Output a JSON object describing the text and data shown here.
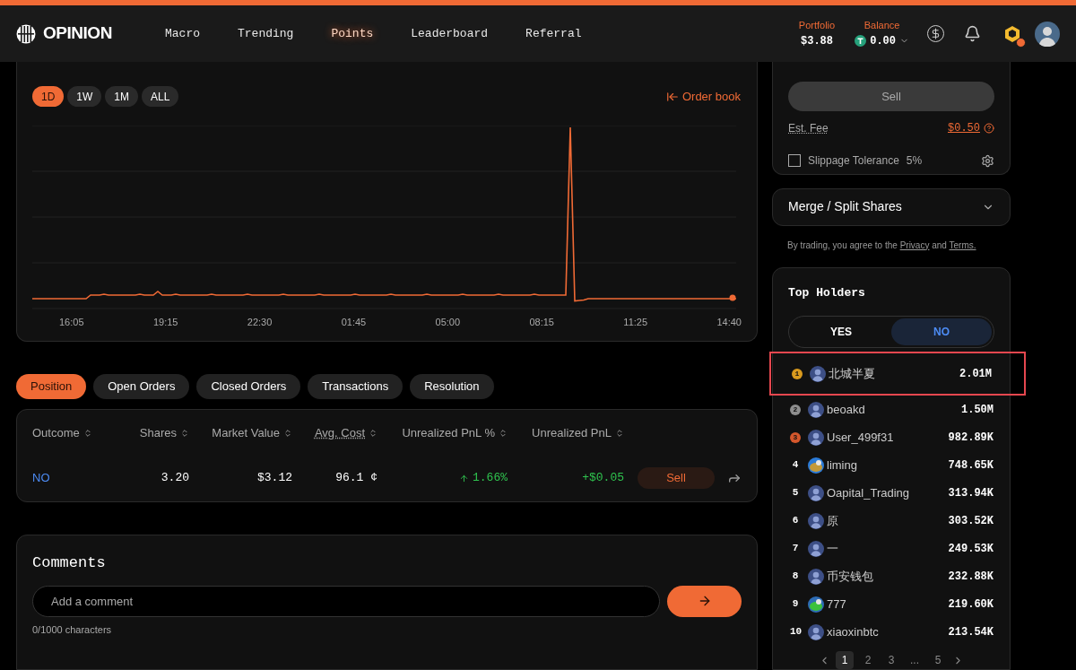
{
  "nav": {
    "logo": "OPINION",
    "links": [
      {
        "label": "Macro",
        "selected": false
      },
      {
        "label": "Trending",
        "selected": false
      },
      {
        "label": "Points",
        "selected": true
      },
      {
        "label": "Leaderboard",
        "selected": false
      },
      {
        "label": "Referral",
        "selected": false
      }
    ]
  },
  "portfolio": {
    "label": "Portfolio",
    "value": "$3.88"
  },
  "balance": {
    "label": "Balance",
    "value": "0.00"
  },
  "chart": {
    "ranges": [
      {
        "label": "1D",
        "selected": true
      },
      {
        "label": "1W",
        "selected": false
      },
      {
        "label": "1M",
        "selected": false
      },
      {
        "label": "ALL",
        "selected": false
      }
    ],
    "order_book": "Order book",
    "x_labels": [
      "16:05",
      "19:15",
      "22:30",
      "01:45",
      "05:00",
      "08:15",
      "11:25",
      "14:40"
    ]
  },
  "position_tabs": [
    {
      "label": "Position",
      "selected": true
    },
    {
      "label": "Open Orders",
      "selected": false
    },
    {
      "label": "Closed Orders",
      "selected": false
    },
    {
      "label": "Transactions",
      "selected": false
    },
    {
      "label": "Resolution",
      "selected": false
    }
  ],
  "positions": {
    "columns": [
      {
        "label": "Outcome",
        "hint": false
      },
      {
        "label": "Shares",
        "hint": false
      },
      {
        "label": "Market Value",
        "hint": false
      },
      {
        "label": "Avg. Cost",
        "hint": true
      },
      {
        "label": "Unrealized PnL %",
        "hint": false
      },
      {
        "label": "Unrealized PnL",
        "hint": false
      }
    ],
    "rows": [
      {
        "outcome": "NO",
        "shares": "3.20",
        "market_value": "$3.12",
        "avg_cost": "96.1 ¢",
        "pnl_pct": "1.66%",
        "pnl": "+$0.05",
        "action": "Sell"
      }
    ]
  },
  "comments": {
    "title": "Comments",
    "placeholder": "Add a comment",
    "counter": "0/1000 characters"
  },
  "trade": {
    "sell_button": "Sell",
    "fee_label": "Est. Fee",
    "fee": "$0.50",
    "slippage": {
      "label": "Slippage Tolerance",
      "value": "5%",
      "checked": false
    }
  },
  "merge": {
    "label": "Merge / Split Shares",
    "expanded": false
  },
  "terms": {
    "text": "By trading, you agree to the",
    "privacy": "Privacy",
    "and": "and",
    "terms": "Terms."
  },
  "holders": {
    "title": "Top Holders",
    "tabs": [
      {
        "label": "YES",
        "selected": false
      },
      {
        "label": "NO",
        "selected": true
      }
    ],
    "rows": [
      {
        "rank": "1",
        "kind": "medal",
        "color": "#d99a1e",
        "avatar": {
          "kind": "default"
        },
        "name": "北城半夏",
        "amount": "2.01M",
        "highlighted": true
      },
      {
        "rank": "2",
        "kind": "medal",
        "color": "#8e8e8e",
        "avatar": {
          "kind": "default"
        },
        "name": "beoakd",
        "amount": "1.50M",
        "highlighted": false
      },
      {
        "rank": "3",
        "kind": "medal",
        "color": "#d4572c",
        "avatar": {
          "kind": "default"
        },
        "name": "User_499f31",
        "amount": "982.89K",
        "highlighted": false
      },
      {
        "rank": "4",
        "kind": "plain",
        "name": "liming",
        "amount": "748.65K",
        "highlighted": false
      },
      {
        "rank": "5",
        "kind": "plain",
        "avatar": {
          "kind": "default"
        },
        "name": "Oapital_Trading",
        "amount": "313.94K",
        "highlighted": false
      },
      {
        "rank": "6",
        "kind": "plain",
        "avatar": {
          "kind": "default"
        },
        "name": "原",
        "amount": "303.52K",
        "highlighted": false
      },
      {
        "rank": "7",
        "kind": "plain",
        "avatar": {
          "kind": "default"
        },
        "name": "一",
        "amount": "249.53K",
        "highlighted": false
      },
      {
        "rank": "8",
        "kind": "plain",
        "avatar": {
          "kind": "default"
        },
        "name": "币安钱包",
        "amount": "232.88K",
        "highlighted": false
      },
      {
        "rank": "9",
        "kind": "plain",
        "name": "777",
        "amount": "219.60K",
        "highlighted": false
      },
      {
        "rank": "10",
        "kind": "plain",
        "avatar": {
          "kind": "default"
        },
        "name": "xiaoxinbtc",
        "amount": "213.54K",
        "highlighted": false
      }
    ],
    "pages": [
      {
        "label": "1",
        "selected": true
      },
      {
        "label": "2",
        "selected": false
      },
      {
        "label": "3",
        "selected": false
      },
      {
        "label": "...",
        "selected": false
      },
      {
        "label": "5",
        "selected": false
      }
    ]
  }
}
